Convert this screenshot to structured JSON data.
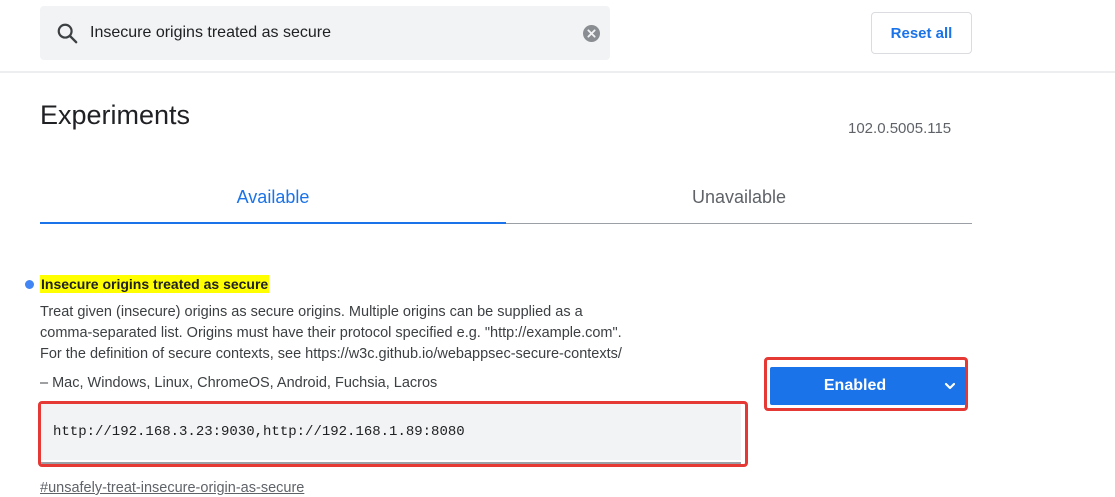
{
  "search": {
    "value": "Insecure origins treated as secure",
    "reset_label": "Reset all"
  },
  "header": {
    "title": "Experiments",
    "version": "102.0.5005.115"
  },
  "tabs": [
    {
      "label": "Available",
      "active": true
    },
    {
      "label": "Unavailable",
      "active": false
    }
  ],
  "flag": {
    "title": "Insecure origins treated as secure",
    "description_lines": [
      "Treat given (insecure) origins as secure origins. Multiple origins can be supplied as a",
      "comma-separated list. Origins must have their protocol specified e.g. \"http://example.com\".",
      "For the definition of secure contexts, see https://w3c.github.io/webappsec-secure-contexts/"
    ],
    "platforms": "– Mac, Windows, Linux, ChromeOS, Android, Fuchsia, Lacros",
    "origins_value": "http://192.168.3.23:9030,http://192.168.1.89:8080",
    "state": "Enabled",
    "anchor": "#unsafely-treat-insecure-origin-as-secure"
  },
  "colors": {
    "accent": "#1a73e8",
    "highlight": "#ffff00",
    "annotation": "#e53935"
  }
}
